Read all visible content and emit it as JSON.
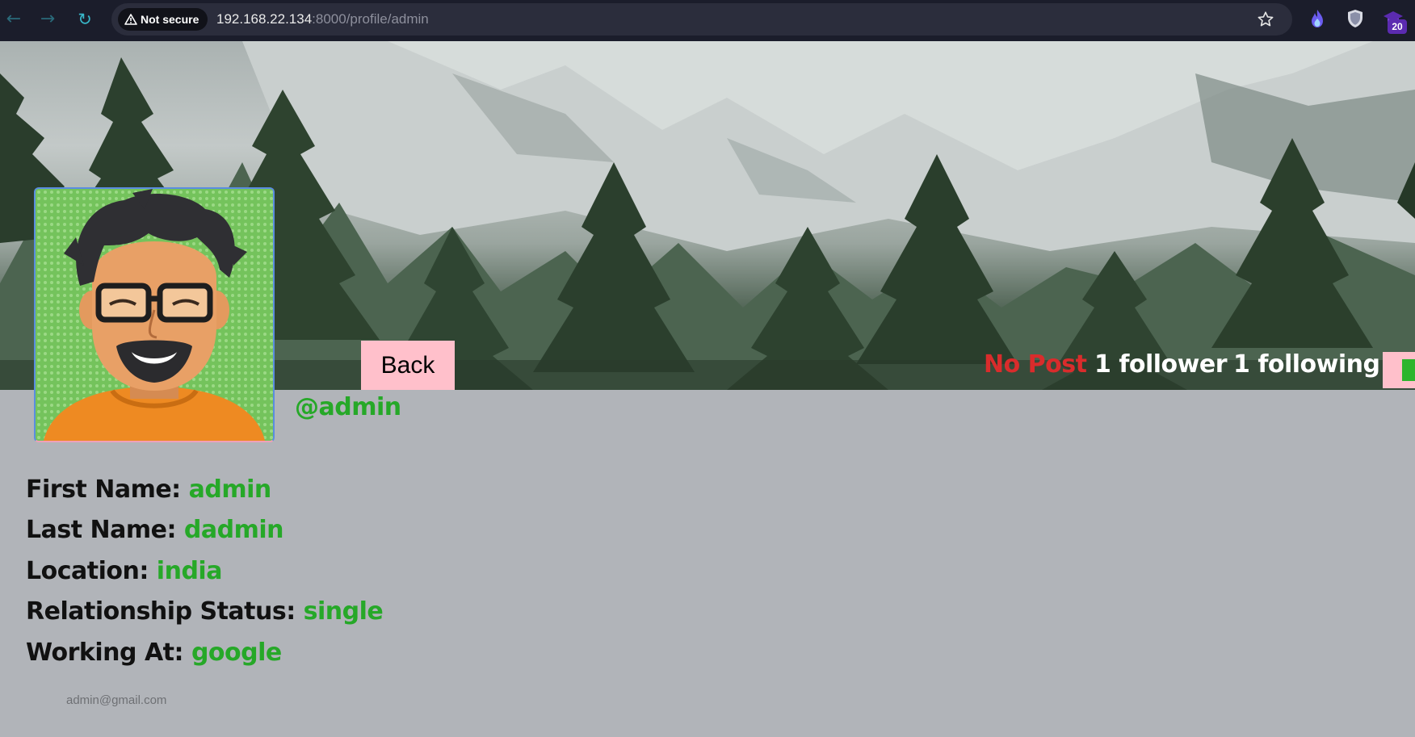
{
  "browser": {
    "security_label": "Not secure",
    "url_host": "192.168.22.134",
    "url_path": ":8000/profile/admin",
    "extension_badge": "20"
  },
  "profile": {
    "back_label": "Back",
    "posts": "No Post",
    "followers": "1 follower",
    "following": "1 following",
    "username": "@admin",
    "fields": [
      {
        "label": "First Name: ",
        "value": "admin"
      },
      {
        "label": "Last Name: ",
        "value": "dadmin"
      },
      {
        "label": "Location: ",
        "value": "india"
      },
      {
        "label": "Relationship Status: ",
        "value": "single"
      },
      {
        "label": "Working At: ",
        "value": "google"
      }
    ],
    "email": "admin@gmail.com"
  },
  "colors": {
    "accent_green": "#26a828",
    "posts_red": "#d92c2c",
    "button_pink": "#ffc0cb",
    "page_bg": "#b1b4b9"
  }
}
